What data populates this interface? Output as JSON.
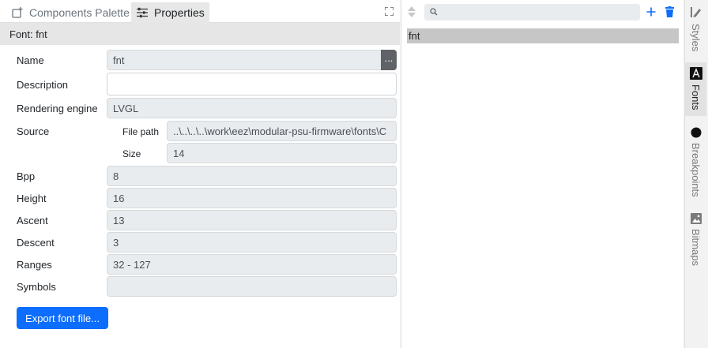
{
  "tabs": {
    "components_palette": "Components Palette",
    "properties": "Properties"
  },
  "section_title": "Font: fnt",
  "props": {
    "name_label": "Name",
    "name_value": "fnt",
    "name_button": "...",
    "description_label": "Description",
    "description_value": "",
    "rendering_engine_label": "Rendering engine",
    "rendering_engine_value": "LVGL",
    "source_label": "Source",
    "file_path_label": "File path",
    "file_path_value": "..\\..\\..\\..\\work\\eez\\modular-psu-firmware\\fonts\\C",
    "size_label": "Size",
    "size_value": "14",
    "bpp_label": "Bpp",
    "bpp_value": "8",
    "height_label": "Height",
    "height_value": "16",
    "ascent_label": "Ascent",
    "ascent_value": "13",
    "descent_label": "Descent",
    "descent_value": "3",
    "ranges_label": "Ranges",
    "ranges_value": "32 - 127",
    "symbols_label": "Symbols",
    "symbols_value": ""
  },
  "export_button": "Export font file...",
  "fonts_list": {
    "search_value": "",
    "items": [
      "fnt"
    ]
  },
  "side_tabs": {
    "styles": "Styles",
    "fonts": "Fonts",
    "breakpoints": "Breakpoints",
    "bitmaps": "Bitmaps"
  },
  "colors": {
    "accent": "#0d6efd",
    "add": "#0d6efd",
    "delete": "#0d6efd"
  }
}
